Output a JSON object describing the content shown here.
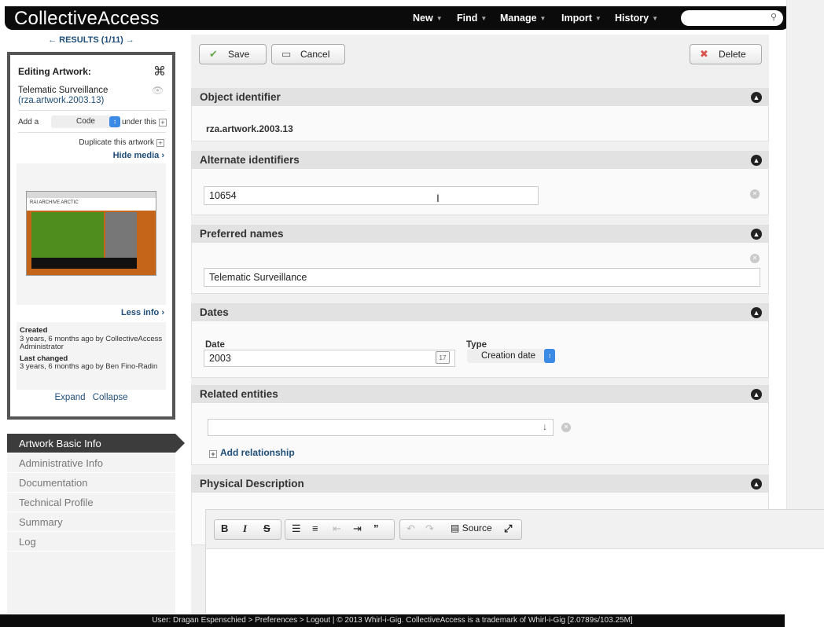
{
  "app": {
    "logo": "CollectiveAccess"
  },
  "nav": {
    "items": [
      "New",
      "Find",
      "Manage",
      "Import",
      "History"
    ],
    "search_placeholder": ""
  },
  "results_nav": {
    "prev": "←",
    "label": "RESULTS (1/11)",
    "next": "→"
  },
  "inspector": {
    "title": "Editing Artwork:",
    "name": "Telematic Surveillance",
    "identifier": "(rza.artwork.2003.13)",
    "add_prefix": "Add a",
    "add_select": "Code",
    "add_suffix": "under this",
    "duplicate": "Duplicate this artwork",
    "hide_media": "Hide media ›",
    "less_info": "Less info ›",
    "thumbnail_caption": "RAI ARCHIVE ARCTIC",
    "created_label": "Created",
    "created_value": "3 years, 6 months ago by CollectiveAccess Administrator",
    "changed_label": "Last changed",
    "changed_value": "3 years, 6 months ago by Ben Fino-Radin",
    "expand": "Expand",
    "collapse": "Collapse"
  },
  "sidebar": {
    "items": [
      {
        "label": "Artwork Basic Info",
        "active": true
      },
      {
        "label": "Administrative Info",
        "active": false
      },
      {
        "label": "Documentation",
        "active": false
      },
      {
        "label": "Technical Profile",
        "active": false
      },
      {
        "label": "Summary",
        "active": false
      },
      {
        "label": "Log",
        "active": false
      }
    ]
  },
  "toolbar": {
    "save": "Save",
    "cancel": "Cancel",
    "delete": "Delete"
  },
  "panels": {
    "object_identifier": {
      "title": "Object identifier",
      "value": "rza.artwork.2003.13"
    },
    "alternate_identifiers": {
      "title": "Alternate identifiers",
      "value": "10654"
    },
    "preferred_names": {
      "title": "Preferred names",
      "value": "Telematic Surveillance"
    },
    "dates": {
      "title": "Dates",
      "date_label": "Date",
      "date_value": "2003",
      "type_label": "Type",
      "type_value": "Creation date"
    },
    "related_entities": {
      "title": "Related entities",
      "value": "",
      "add_relationship": "Add relationship"
    },
    "physical_description": {
      "title": "Physical Description"
    }
  },
  "editor": {
    "bold": "B",
    "italic": "I",
    "strike": "S",
    "source": "Source"
  },
  "footer": {
    "text": "User: Dragan Espenschied > Preferences > Logout  |  © 2013 Whirl-i-Gig. CollectiveAccess is a trademark of Whirl-i-Gig [2.0789s/103.25M]"
  },
  "colors": {
    "topbar": "#0b0b0b",
    "link": "#1f4e79",
    "active_nav": "#3c3c3c",
    "panel_header": "#e2e2e2"
  }
}
